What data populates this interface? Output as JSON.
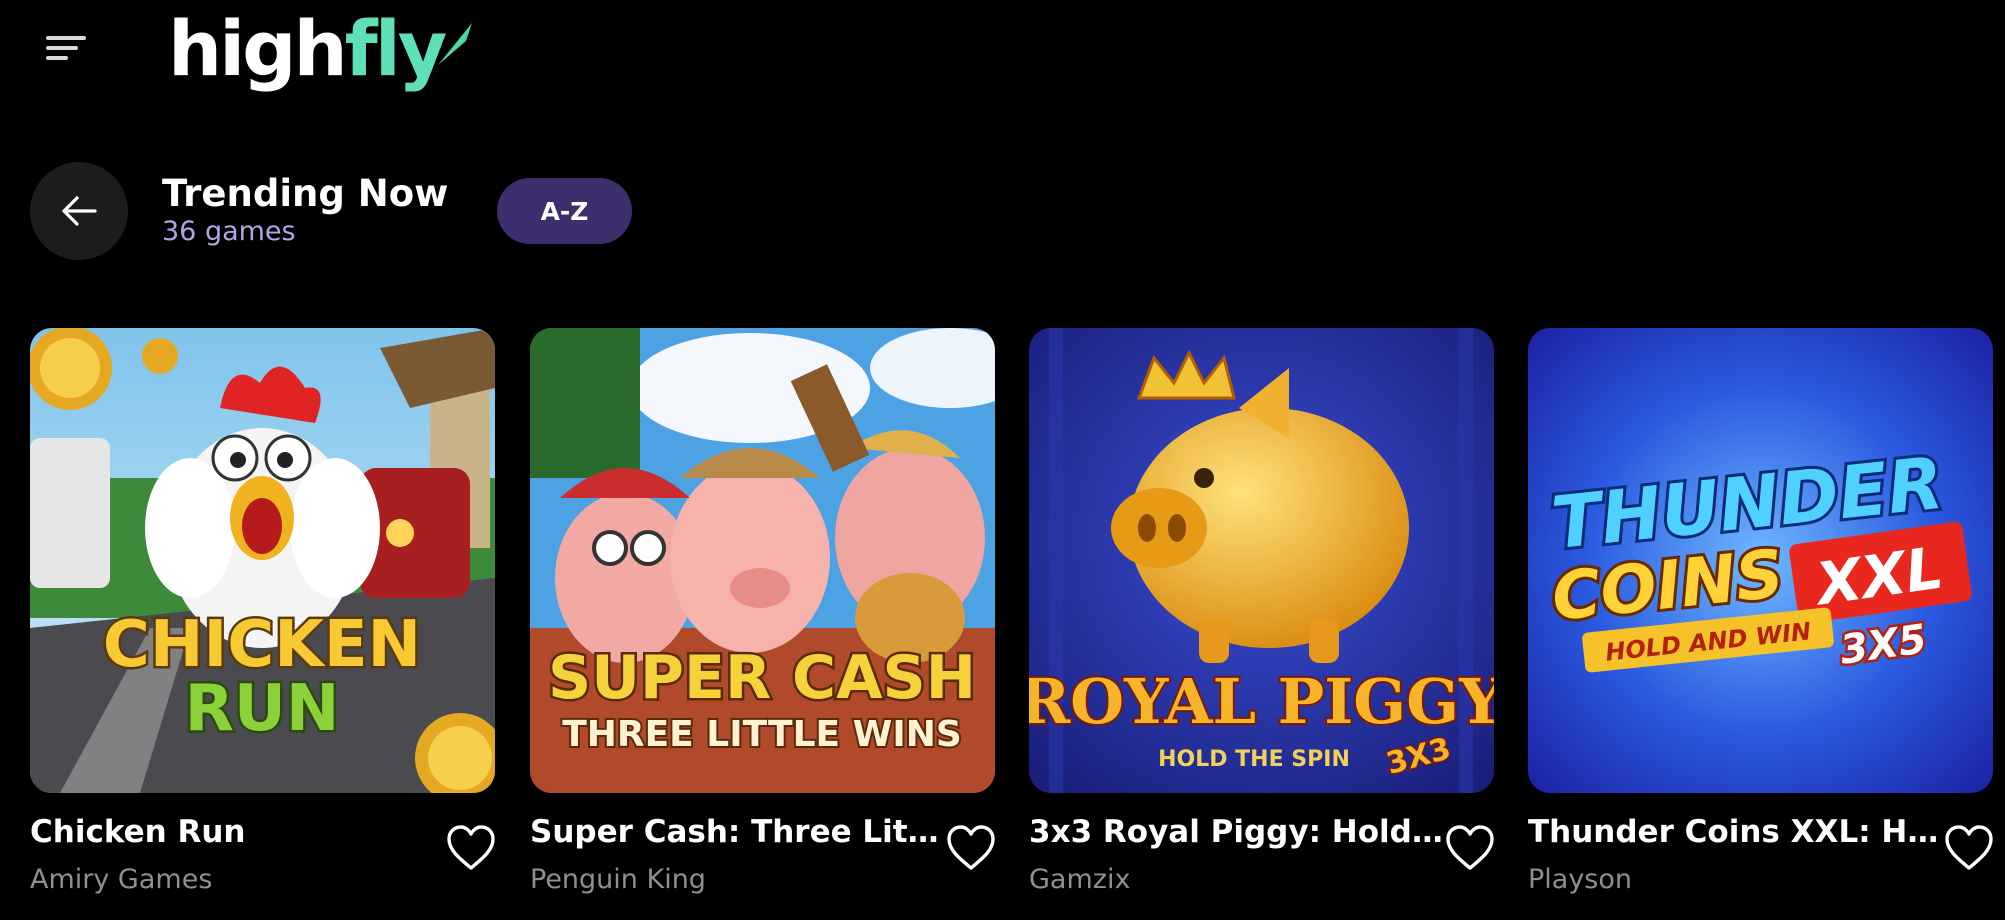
{
  "brand": {
    "logo_part1": "high",
    "logo_part2": "fly"
  },
  "icons": {
    "menu": "menu-icon",
    "back": "arrow-left-icon",
    "favorite": "heart-icon"
  },
  "colors": {
    "background": "#000000",
    "accent": "#3d2f6e",
    "logo_accent": "#5fe0b8",
    "subtitle": "#b3a4e3",
    "provider": "#8f8f8f"
  },
  "section": {
    "title": "Trending Now",
    "count": "36 games",
    "sort_label": "A-Z"
  },
  "games": [
    {
      "title": "Chicken Run",
      "provider": "Amiry Games",
      "art_line1": "CHICKEN",
      "art_line2": "RUN"
    },
    {
      "title": "Super Cash: Three Little ...",
      "provider": "Penguin King",
      "art_line1": "SUPER CASH",
      "art_line2": "THREE LITTLE WINS"
    },
    {
      "title": "3x3 Royal Piggy: Hold Th...",
      "provider": "Gamzix",
      "art_line1": "ROYAL PIGGY",
      "art_line2": "HOLD THE SPIN",
      "art_badge": "3X3"
    },
    {
      "title": "Thunder Coins XXL: Hol...",
      "provider": "Playson",
      "art_line1": "THUNDER",
      "art_line2": "COINS",
      "art_badge": "XXL",
      "art_line3": "HOLD AND WIN",
      "art_badge2": "3X5"
    }
  ]
}
